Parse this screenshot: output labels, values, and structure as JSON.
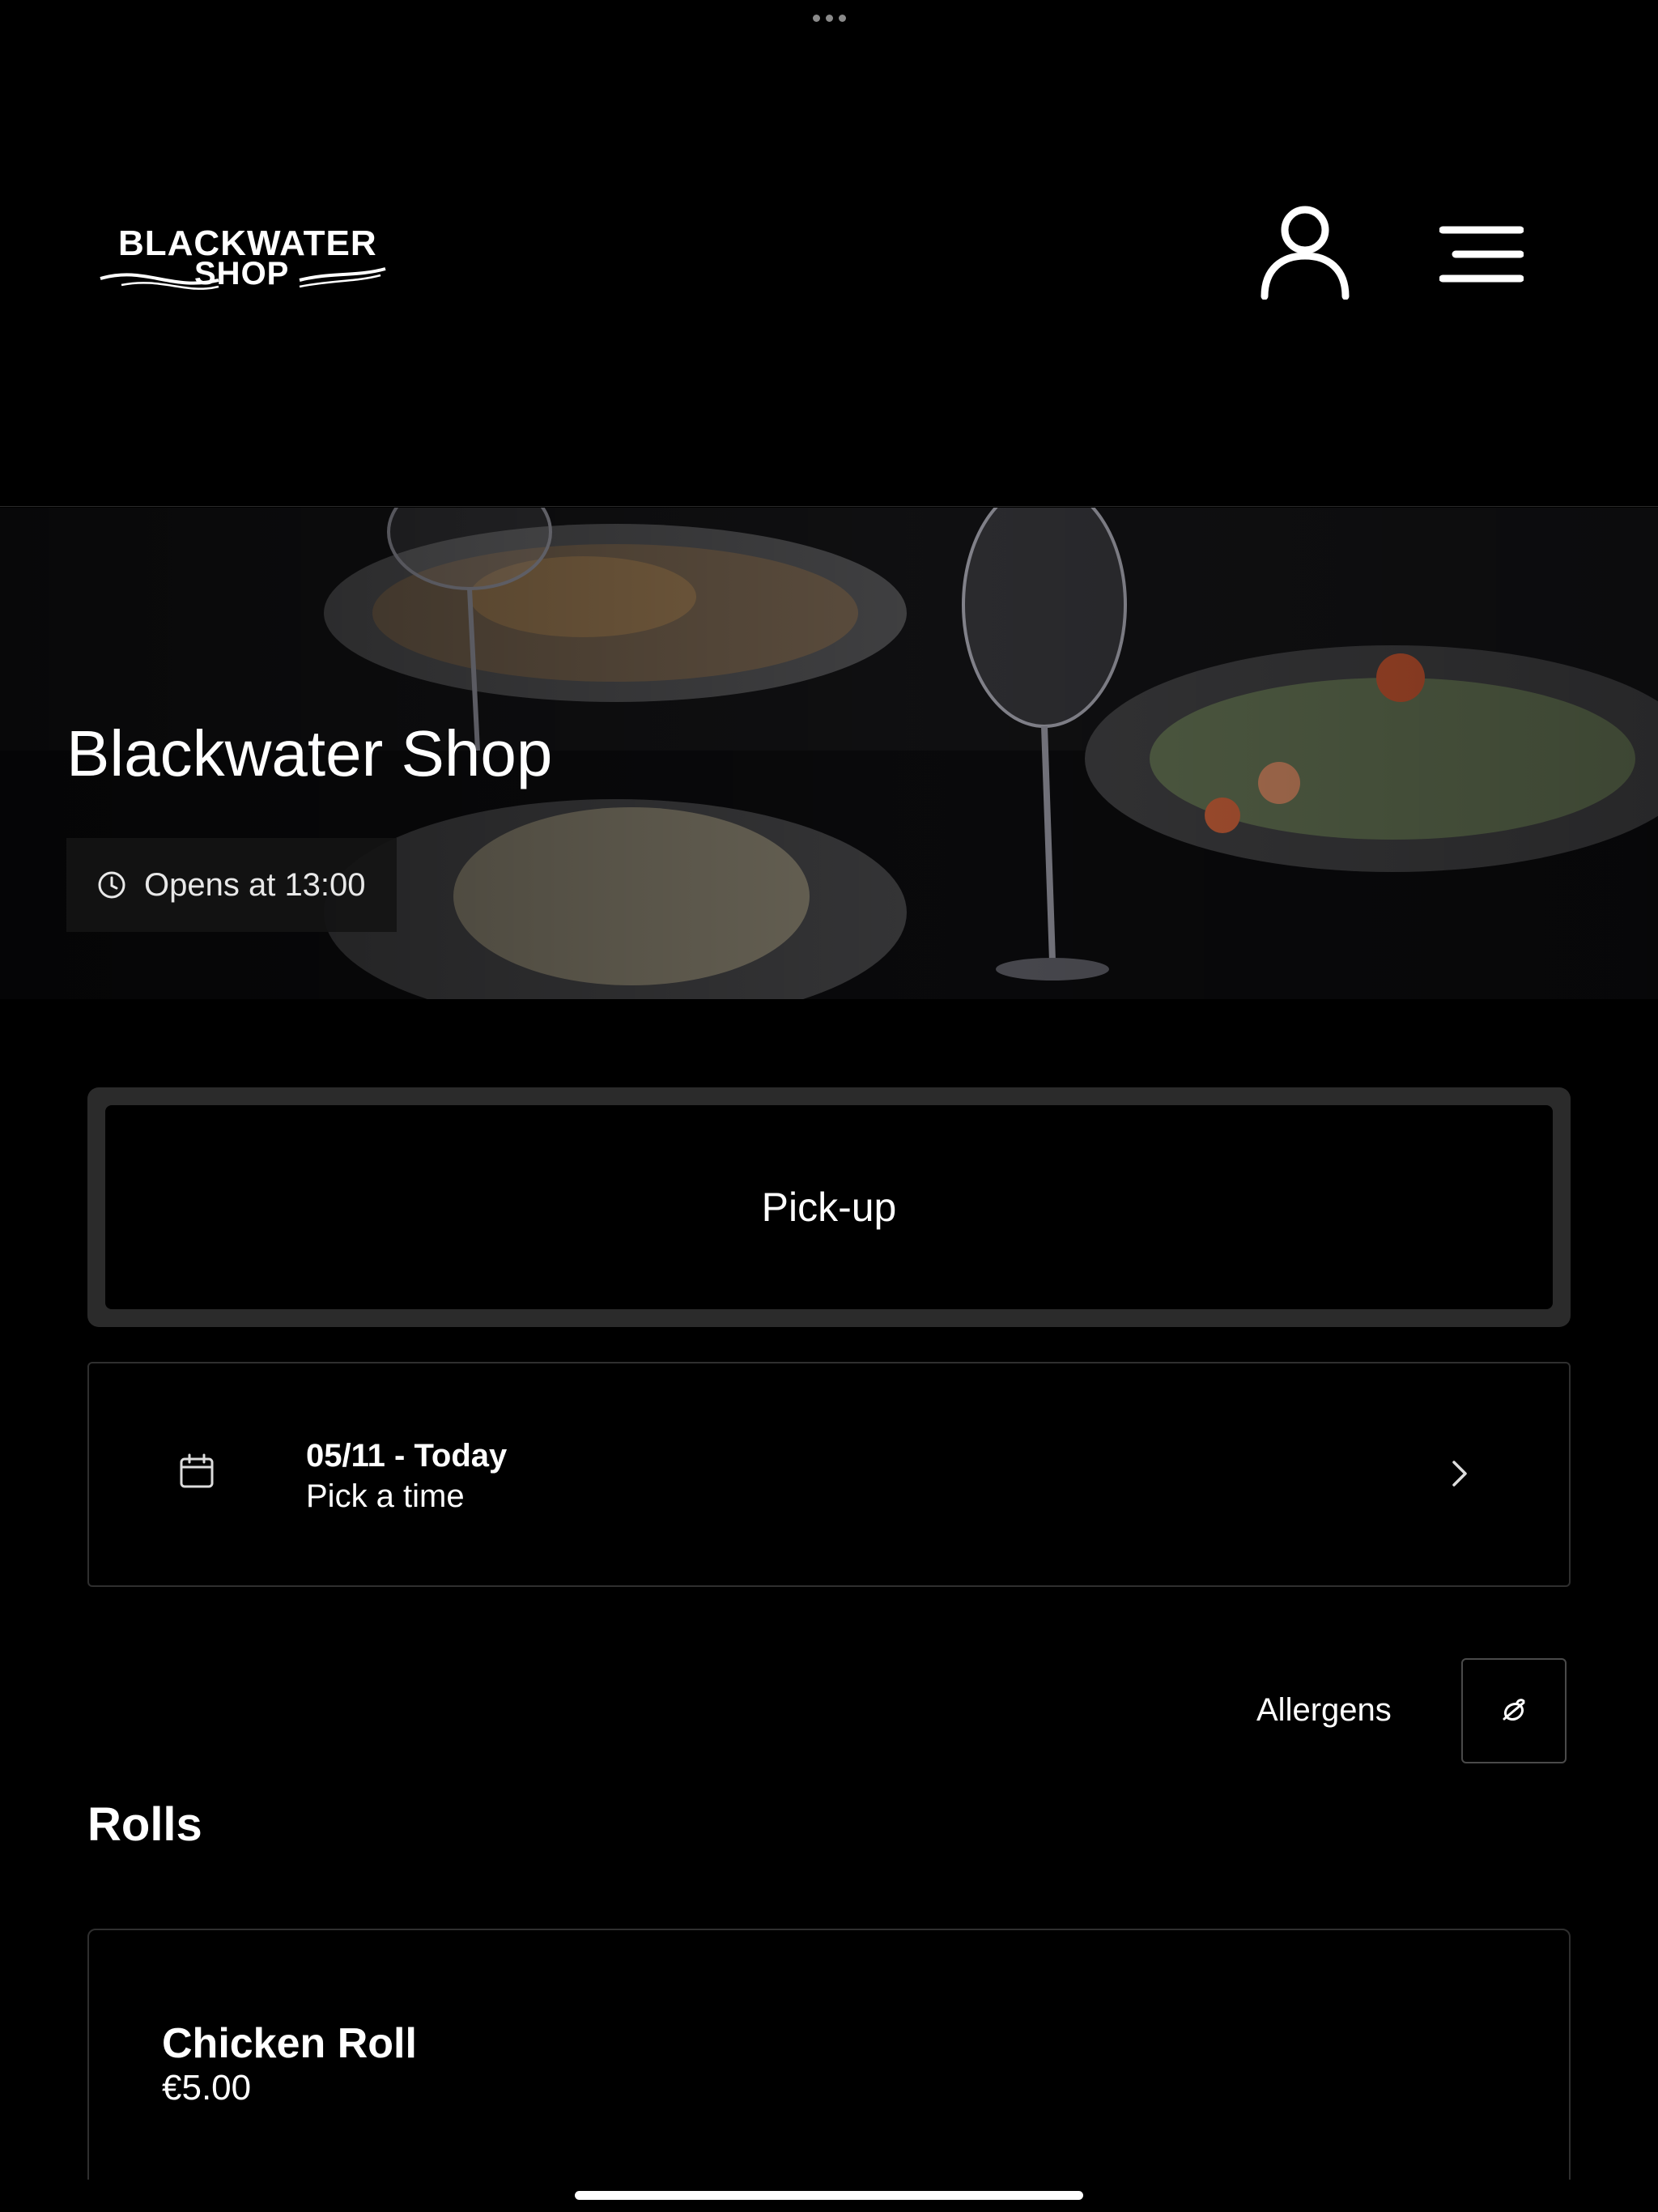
{
  "header": {
    "logo_line1": "BLACKWATER",
    "logo_line2": "SHOP",
    "account_icon": "user-icon",
    "menu_icon": "hamburger-menu-icon"
  },
  "hero": {
    "title": "Blackwater Shop",
    "opens_text": "Opens at 13:00",
    "clock_icon": "clock-icon"
  },
  "order_mode": {
    "label": "Pick-up"
  },
  "schedule": {
    "date_label": "05/11 - Today",
    "time_label": "Pick a time",
    "calendar_icon": "calendar-icon",
    "chevron_icon": "chevron-right-icon"
  },
  "allergens": {
    "label": "Allergens",
    "icon": "allergen-filter-icon"
  },
  "menu": {
    "sections": [
      {
        "title": "Rolls",
        "items": [
          {
            "name": "Chicken Roll",
            "price": "€5.00"
          }
        ]
      }
    ]
  },
  "colors": {
    "background": "#000000",
    "text": "#ffffff",
    "card_border": "#2f2f2f",
    "pickup_frame": "#2b2b2b"
  }
}
